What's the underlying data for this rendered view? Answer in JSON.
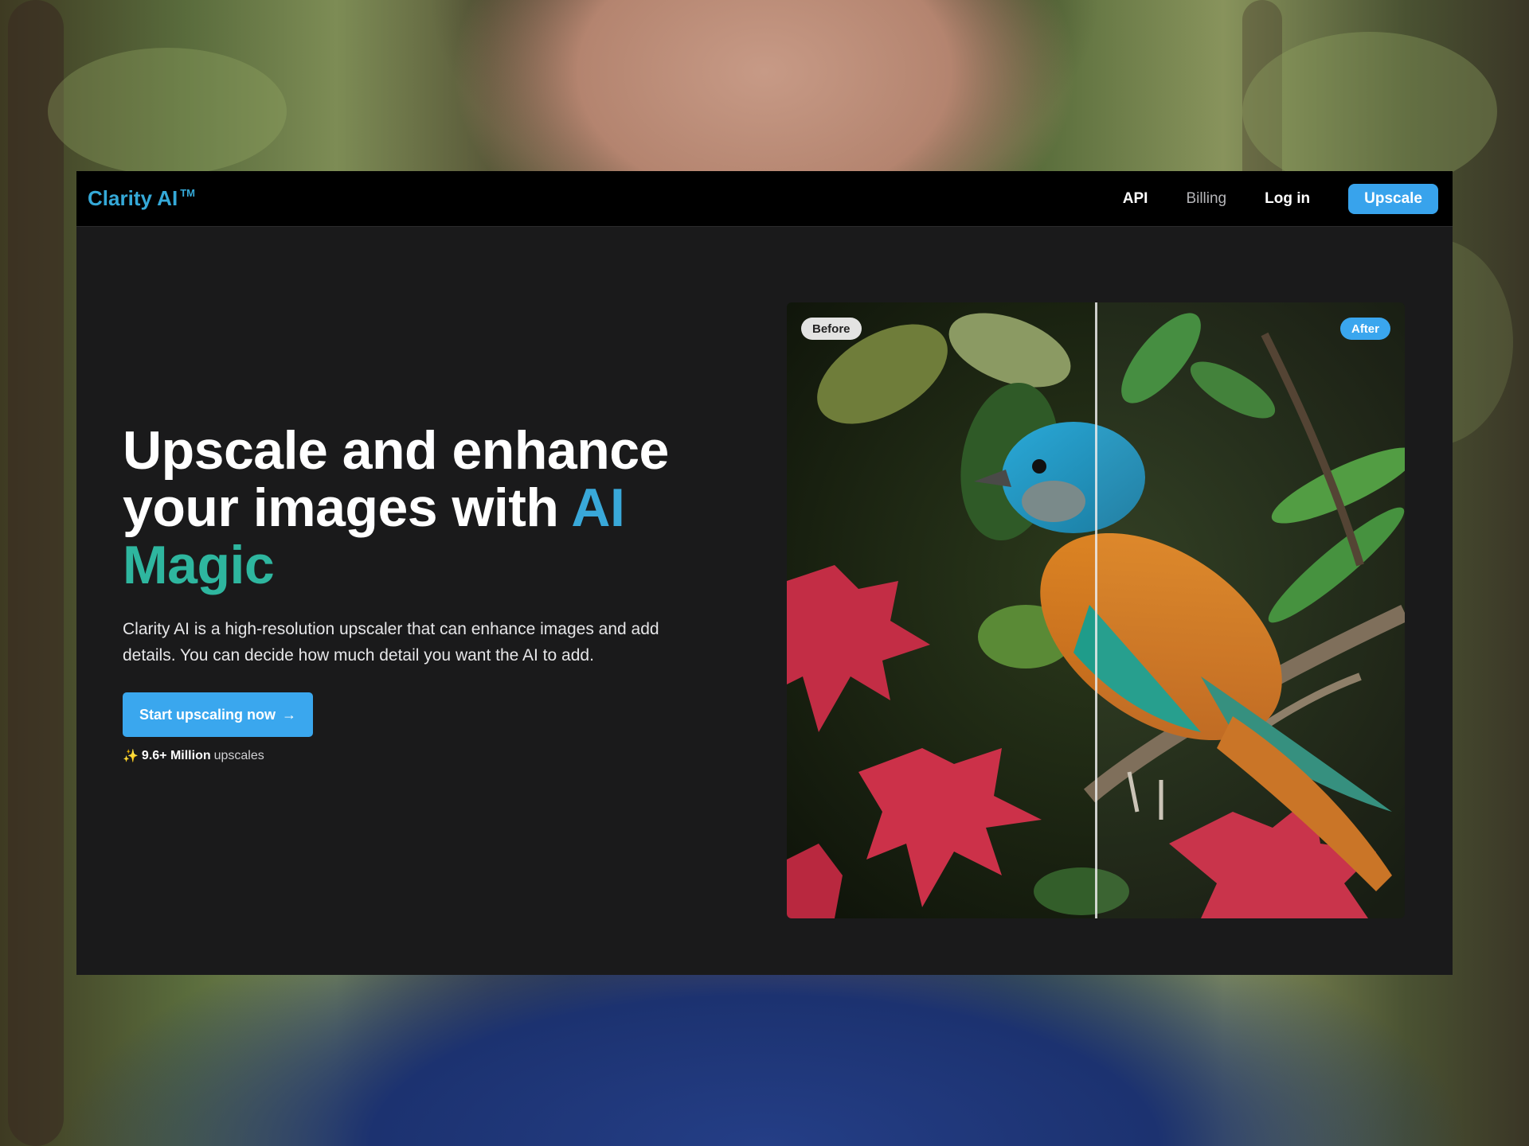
{
  "navbar": {
    "brand": "Clarity AI",
    "brand_mark": "TM",
    "links": {
      "api": "API",
      "billing": "Billing",
      "login": "Log in"
    },
    "upscale_label": "Upscale"
  },
  "hero": {
    "title_line1": "Upscale and enhance",
    "title_line2": "your images with",
    "title_accent1": "AI",
    "title_accent2": "Magic",
    "description": "Clarity AI is a high-resolution upscaler that can enhance images and add details. You can decide how much detail you want the AI to add.",
    "cta_label": "Start upscaling now",
    "cta_arrow": "→",
    "stat_icon": "sparkles-icon",
    "stat_strong": "9.6+ Million",
    "stat_rest": "upscales"
  },
  "comparison": {
    "before_label": "Before",
    "after_label": "After",
    "split_fraction": 0.5
  },
  "colors": {
    "brand": "#35a9d8",
    "accent_ai": "#39a8d9",
    "accent_magic": "#2eb69f",
    "button": "#38a3ec",
    "panel_bg": "#1a1a1b",
    "navbar_bg": "#000000"
  }
}
